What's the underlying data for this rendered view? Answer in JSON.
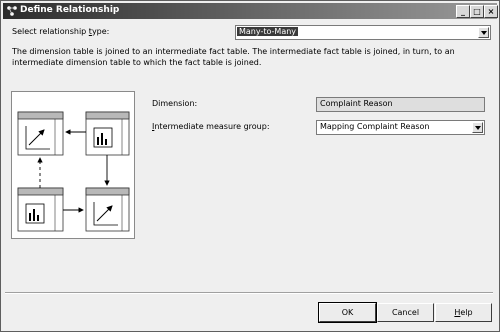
{
  "window": {
    "title": "Define Relationship",
    "controls": {
      "minimize": "_",
      "maximize": "□",
      "close": "×"
    }
  },
  "relationship_type": {
    "label_prefix": "Select relationship ",
    "label_hotkey": "t",
    "label_suffix": "ype:",
    "value": "Many-to-Many"
  },
  "description": "The dimension table is joined to an intermediate fact table. The intermediate fact table is joined, in turn, to an intermediate dimension table to which the fact table is joined.",
  "dimension": {
    "label": "Dimension:",
    "value": "Complaint Reason"
  },
  "measure_group": {
    "label_hotkey": "I",
    "label_rest": "ntermediate measure group:",
    "value": "Mapping Complaint Reason"
  },
  "buttons": {
    "ok": "OK",
    "cancel": "Cancel",
    "help_hotkey": "H",
    "help_rest": "elp"
  },
  "icons": {
    "app": "relationship-app-icon",
    "dimension_table": "dimension-table-icon",
    "fact_table": "fact-table-icon"
  }
}
